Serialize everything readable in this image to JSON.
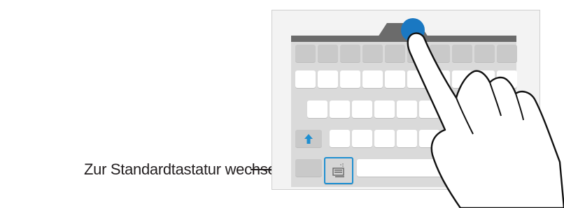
{
  "callout": {
    "label": "Zur Standardtastatur wechseln."
  },
  "icons": {
    "shift": "shift-arrow-icon",
    "keyboard_switch": "keyboard-switch-icon",
    "finger": "hand-pointer-icon"
  },
  "colors": {
    "accent": "#1e8fd1",
    "touch": "#1a78c2",
    "keyboard_bg": "#dadada",
    "header": "#6b6b6b"
  }
}
